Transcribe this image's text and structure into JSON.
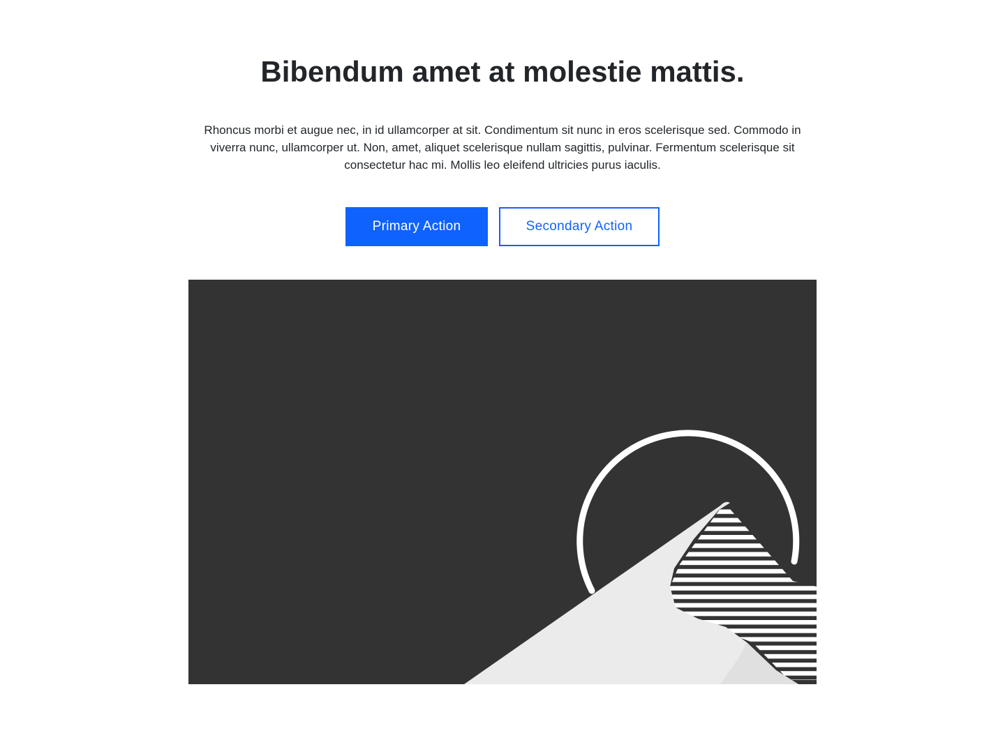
{
  "hero": {
    "title": "Bibendum amet at molestie mattis.",
    "body": "Rhoncus morbi et augue nec, in id ullamcorper at sit. Condimentum sit nunc in eros scelerisque sed. Commodo in viverra nunc, ullamcorper ut. Non, amet, aliquet scelerisque nullam sagittis, pulvinar. Fermentum scelerisque sit consectetur hac mi. Mollis leo eleifend ultricies purus iaculis.",
    "primary_action_label": "Primary Action",
    "secondary_action_label": "Secondary Action"
  },
  "colors": {
    "accent": "#0f62fe",
    "text": "#22262a",
    "image_background": "#333333",
    "mountain": "#ebebeb",
    "mountain_shadow": "#dcdcdc",
    "stripes": "#ffffff"
  },
  "image": {
    "icon": "mountain-sun-illustration"
  }
}
